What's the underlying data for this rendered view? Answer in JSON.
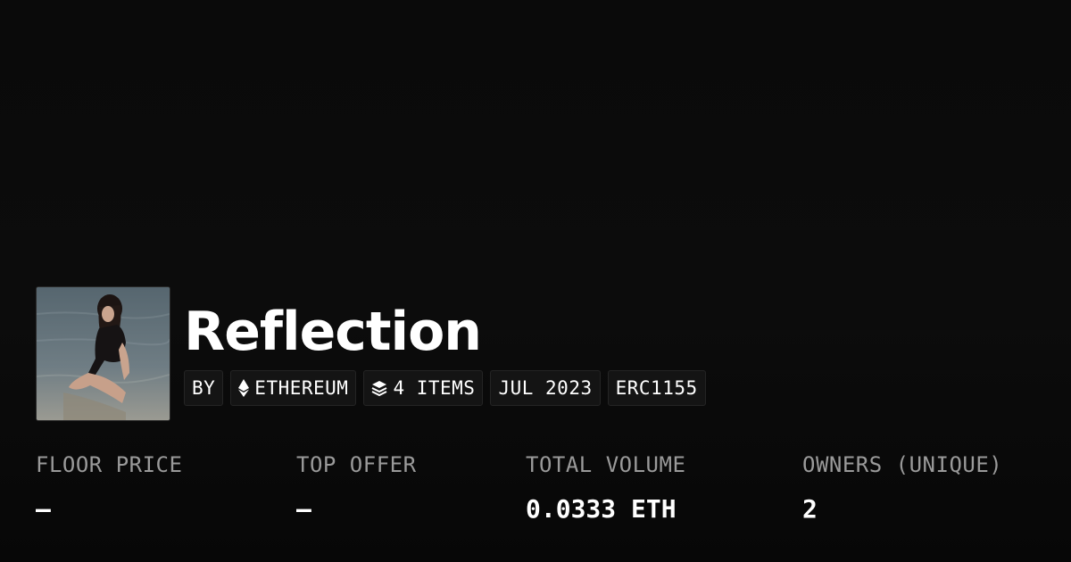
{
  "collection": {
    "name": "Reflection",
    "avatar_alt": "avatar"
  },
  "tags": [
    {
      "label": "BY",
      "icon": null
    },
    {
      "label": "ETHEREUM",
      "icon": "ethereum-icon"
    },
    {
      "label": "4 ITEMS",
      "icon": "layers-icon"
    },
    {
      "label": "JUL 2023",
      "icon": null
    },
    {
      "label": "ERC1155",
      "icon": null
    }
  ],
  "stats": [
    {
      "label": "FLOOR PRICE",
      "value": "—"
    },
    {
      "label": "TOP OFFER",
      "value": "—"
    },
    {
      "label": "TOTAL VOLUME",
      "value": "0.0333 ETH"
    },
    {
      "label": "OWNERS (UNIQUE)",
      "value": "2"
    }
  ],
  "colors": {
    "background": "#0b0b0b",
    "text": "#ffffff",
    "muted_label": "#9a9a9a",
    "tag_bg": "#141414"
  }
}
